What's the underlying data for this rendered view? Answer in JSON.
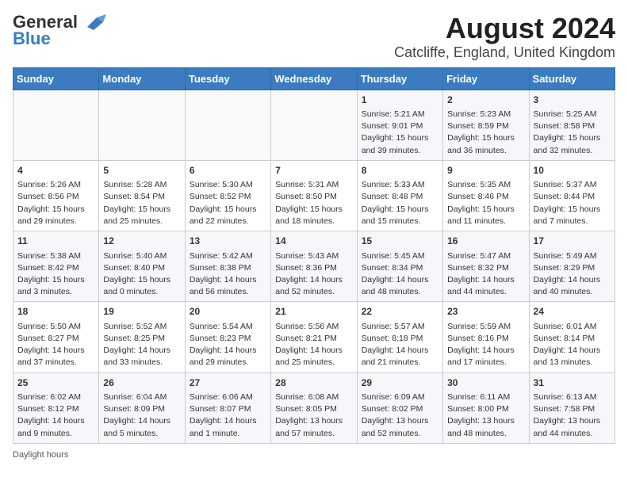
{
  "header": {
    "logo_general": "General",
    "logo_blue": "Blue",
    "title": "August 2024",
    "subtitle": "Catcliffe, England, United Kingdom"
  },
  "calendar": {
    "days_of_week": [
      "Sunday",
      "Monday",
      "Tuesday",
      "Wednesday",
      "Thursday",
      "Friday",
      "Saturday"
    ],
    "weeks": [
      [
        {
          "day": "",
          "content": ""
        },
        {
          "day": "",
          "content": ""
        },
        {
          "day": "",
          "content": ""
        },
        {
          "day": "",
          "content": ""
        },
        {
          "day": "1",
          "content": "Sunrise: 5:21 AM\nSunset: 9:01 PM\nDaylight: 15 hours and 39 minutes."
        },
        {
          "day": "2",
          "content": "Sunrise: 5:23 AM\nSunset: 8:59 PM\nDaylight: 15 hours and 36 minutes."
        },
        {
          "day": "3",
          "content": "Sunrise: 5:25 AM\nSunset: 8:58 PM\nDaylight: 15 hours and 32 minutes."
        }
      ],
      [
        {
          "day": "4",
          "content": "Sunrise: 5:26 AM\nSunset: 8:56 PM\nDaylight: 15 hours and 29 minutes."
        },
        {
          "day": "5",
          "content": "Sunrise: 5:28 AM\nSunset: 8:54 PM\nDaylight: 15 hours and 25 minutes."
        },
        {
          "day": "6",
          "content": "Sunrise: 5:30 AM\nSunset: 8:52 PM\nDaylight: 15 hours and 22 minutes."
        },
        {
          "day": "7",
          "content": "Sunrise: 5:31 AM\nSunset: 8:50 PM\nDaylight: 15 hours and 18 minutes."
        },
        {
          "day": "8",
          "content": "Sunrise: 5:33 AM\nSunset: 8:48 PM\nDaylight: 15 hours and 15 minutes."
        },
        {
          "day": "9",
          "content": "Sunrise: 5:35 AM\nSunset: 8:46 PM\nDaylight: 15 hours and 11 minutes."
        },
        {
          "day": "10",
          "content": "Sunrise: 5:37 AM\nSunset: 8:44 PM\nDaylight: 15 hours and 7 minutes."
        }
      ],
      [
        {
          "day": "11",
          "content": "Sunrise: 5:38 AM\nSunset: 8:42 PM\nDaylight: 15 hours and 3 minutes."
        },
        {
          "day": "12",
          "content": "Sunrise: 5:40 AM\nSunset: 8:40 PM\nDaylight: 15 hours and 0 minutes."
        },
        {
          "day": "13",
          "content": "Sunrise: 5:42 AM\nSunset: 8:38 PM\nDaylight: 14 hours and 56 minutes."
        },
        {
          "day": "14",
          "content": "Sunrise: 5:43 AM\nSunset: 8:36 PM\nDaylight: 14 hours and 52 minutes."
        },
        {
          "day": "15",
          "content": "Sunrise: 5:45 AM\nSunset: 8:34 PM\nDaylight: 14 hours and 48 minutes."
        },
        {
          "day": "16",
          "content": "Sunrise: 5:47 AM\nSunset: 8:32 PM\nDaylight: 14 hours and 44 minutes."
        },
        {
          "day": "17",
          "content": "Sunrise: 5:49 AM\nSunset: 8:29 PM\nDaylight: 14 hours and 40 minutes."
        }
      ],
      [
        {
          "day": "18",
          "content": "Sunrise: 5:50 AM\nSunset: 8:27 PM\nDaylight: 14 hours and 37 minutes."
        },
        {
          "day": "19",
          "content": "Sunrise: 5:52 AM\nSunset: 8:25 PM\nDaylight: 14 hours and 33 minutes."
        },
        {
          "day": "20",
          "content": "Sunrise: 5:54 AM\nSunset: 8:23 PM\nDaylight: 14 hours and 29 minutes."
        },
        {
          "day": "21",
          "content": "Sunrise: 5:56 AM\nSunset: 8:21 PM\nDaylight: 14 hours and 25 minutes."
        },
        {
          "day": "22",
          "content": "Sunrise: 5:57 AM\nSunset: 8:18 PM\nDaylight: 14 hours and 21 minutes."
        },
        {
          "day": "23",
          "content": "Sunrise: 5:59 AM\nSunset: 8:16 PM\nDaylight: 14 hours and 17 minutes."
        },
        {
          "day": "24",
          "content": "Sunrise: 6:01 AM\nSunset: 8:14 PM\nDaylight: 14 hours and 13 minutes."
        }
      ],
      [
        {
          "day": "25",
          "content": "Sunrise: 6:02 AM\nSunset: 8:12 PM\nDaylight: 14 hours and 9 minutes."
        },
        {
          "day": "26",
          "content": "Sunrise: 6:04 AM\nSunset: 8:09 PM\nDaylight: 14 hours and 5 minutes."
        },
        {
          "day": "27",
          "content": "Sunrise: 6:06 AM\nSunset: 8:07 PM\nDaylight: 14 hours and 1 minute."
        },
        {
          "day": "28",
          "content": "Sunrise: 6:08 AM\nSunset: 8:05 PM\nDaylight: 13 hours and 57 minutes."
        },
        {
          "day": "29",
          "content": "Sunrise: 6:09 AM\nSunset: 8:02 PM\nDaylight: 13 hours and 52 minutes."
        },
        {
          "day": "30",
          "content": "Sunrise: 6:11 AM\nSunset: 8:00 PM\nDaylight: 13 hours and 48 minutes."
        },
        {
          "day": "31",
          "content": "Sunrise: 6:13 AM\nSunset: 7:58 PM\nDaylight: 13 hours and 44 minutes."
        }
      ]
    ]
  },
  "footer": {
    "text": "Daylight hours"
  }
}
